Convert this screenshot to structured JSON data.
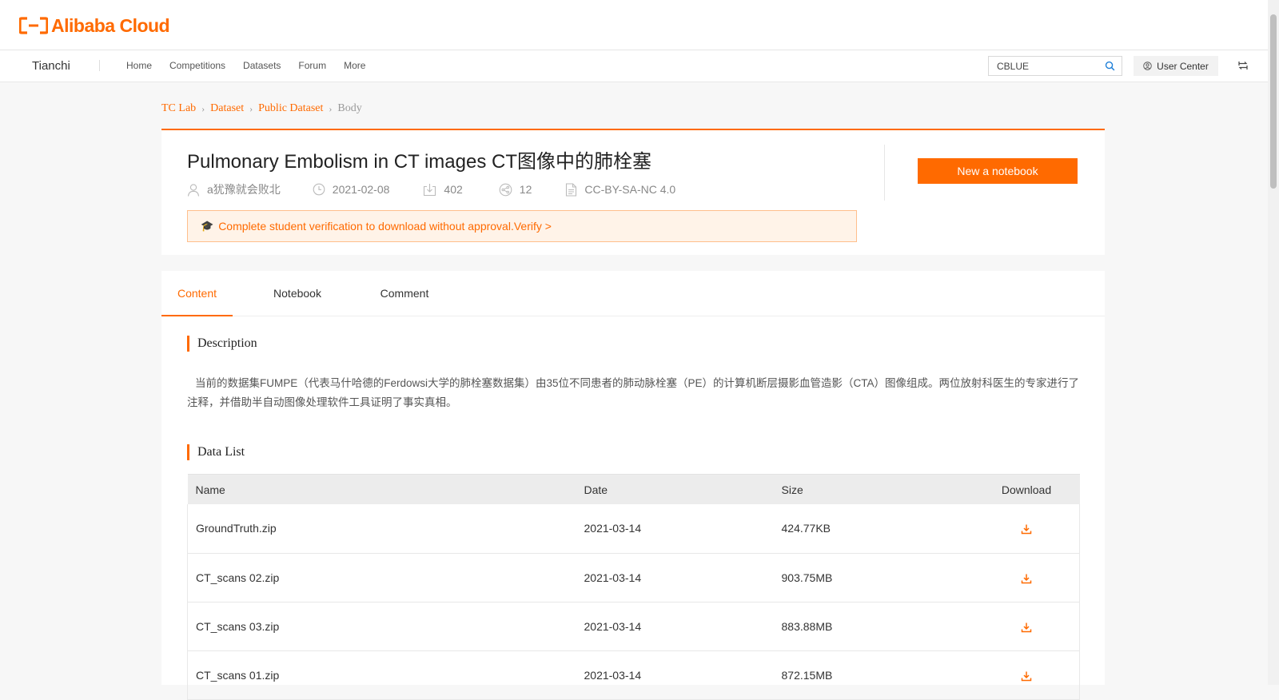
{
  "logo": {
    "text": "Alibaba Cloud"
  },
  "nav": {
    "brand": "Tianchi",
    "links": [
      "Home",
      "Competitions",
      "Datasets",
      "Forum",
      "More"
    ],
    "search_value": "CBLUE",
    "user_center": "User Center"
  },
  "breadcrumb": [
    "TC Lab",
    "Dataset",
    "Public Dataset",
    "Body"
  ],
  "dataset": {
    "title": "Pulmonary Embolism in CT images CT图像中的肺栓塞",
    "author": "a犹豫就会败北",
    "date": "2021-02-08",
    "downloads": "402",
    "shares": "12",
    "license": "CC-BY-SA-NC 4.0",
    "alert": "Complete student verification to download without approval.Verify >",
    "new_notebook": "New a notebook"
  },
  "tabs": [
    "Content",
    "Notebook",
    "Comment"
  ],
  "description": {
    "title": "Description",
    "text": "当前的数据集FUMPE（代表马什哈德的Ferdowsi大学的肺栓塞数据集）由35位不同患者的肺动脉栓塞（PE）的计算机断层摄影血管造影（CTA）图像组成。两位放射科医生的专家进行了注释，并借助半自动图像处理软件工具证明了事实真相。"
  },
  "data_list": {
    "title": "Data List",
    "columns": {
      "name": "Name",
      "date": "Date",
      "size": "Size",
      "download": "Download"
    },
    "rows": [
      {
        "name": "GroundTruth.zip",
        "date": "2021-03-14",
        "size": "424.77KB"
      },
      {
        "name": "CT_scans 02.zip",
        "date": "2021-03-14",
        "size": "903.75MB"
      },
      {
        "name": "CT_scans 03.zip",
        "date": "2021-03-14",
        "size": "883.88MB"
      },
      {
        "name": "CT_scans 01.zip",
        "date": "2021-03-14",
        "size": "872.15MB"
      }
    ]
  },
  "colors": {
    "accent": "#ff6a00",
    "alert_bg": "#fff3e8",
    "page_bg": "#f7f7f7"
  },
  "icons": [
    "user-icon",
    "clock-icon",
    "download-icon",
    "share-icon",
    "document-icon",
    "graduation-cap-icon",
    "search-icon",
    "user-circle-icon",
    "switch-icon"
  ]
}
